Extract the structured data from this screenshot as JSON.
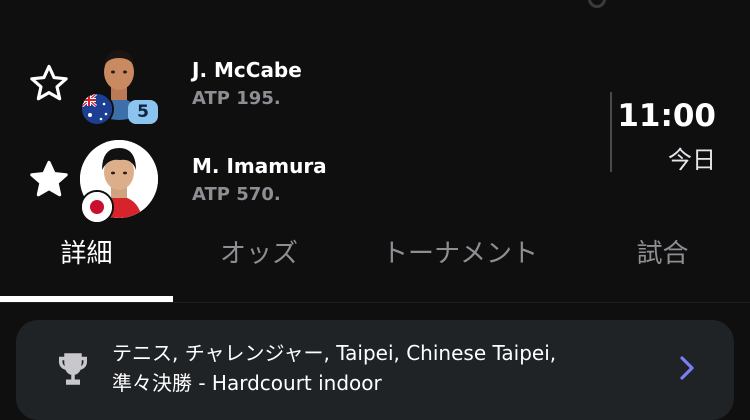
{
  "players": [
    {
      "name": "J. McCabe",
      "rank": "ATP 195.",
      "seed": "5",
      "flag": "australia-flag-icon",
      "favorite": false
    },
    {
      "name": "M. Imamura",
      "rank": "ATP 570.",
      "seed": "",
      "flag": "japan-flag-icon",
      "favorite": true
    }
  ],
  "match": {
    "time": "11:00",
    "day": "今日"
  },
  "tabs": [
    {
      "label": "詳細",
      "active": true
    },
    {
      "label": "オッズ",
      "active": false
    },
    {
      "label": "トーナメント",
      "active": false
    },
    {
      "label": "試合",
      "active": false
    }
  ],
  "tournament": {
    "line1": "テニス, チャレンジャー, Taipei, Chinese Taipei,",
    "line2": "準々決勝 - Hardcourt indoor",
    "icon": "trophy-icon"
  },
  "colors": {
    "background": "#0f0f10",
    "accent": "#7b7df0",
    "seed_badge": "#8cc4f0",
    "muted": "#8e8e93"
  }
}
